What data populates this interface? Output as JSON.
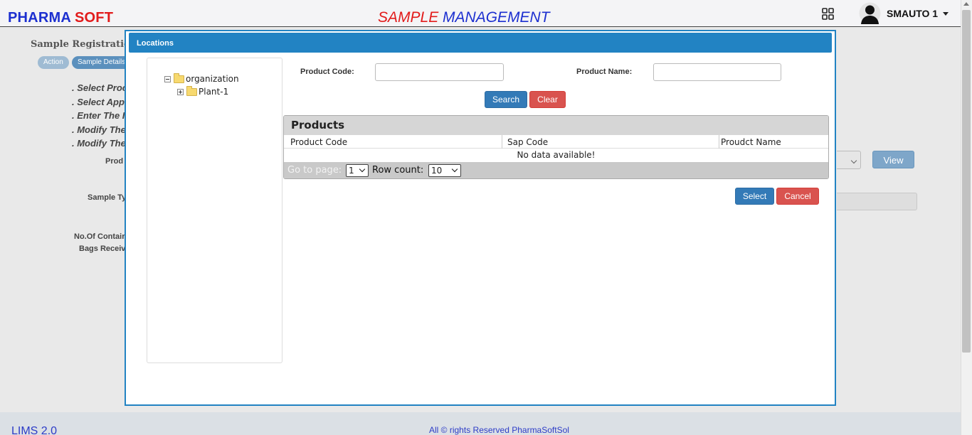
{
  "header": {
    "brand_part1": "PHARMA",
    "brand_part2": "SOFT",
    "title_part1": "SAMPLE",
    "title_part2": "MANAGEMENT",
    "apps_icon": "grid-icon",
    "username": "SMAUTO 1"
  },
  "background": {
    "page_title": "Sample Registration",
    "pills": [
      "Action",
      "Sample Details"
    ],
    "instructions": [
      ". Select Proc",
      ". Select App",
      ". Enter The I",
      ". Modify The",
      ". Modify The"
    ],
    "labels": [
      "Prod",
      "Sample Ty",
      "No.Of Contair",
      "Bags Receiv"
    ],
    "view_button": "View"
  },
  "modal": {
    "title": "Locations",
    "tree": {
      "root": "organization",
      "children": [
        "Plant-1"
      ]
    },
    "product_code_label": "Product Code:",
    "product_code_value": "",
    "product_name_label": "Product Name:",
    "product_name_value": "",
    "search_button": "Search",
    "clear_button": "Clear",
    "grid": {
      "caption": "Products",
      "columns": [
        "Product Code",
        "Sap Code",
        "Proudct Name"
      ],
      "empty_text": "No data available!",
      "go_to_page_label": "Go to page:",
      "page_value": "1",
      "row_count_label": "Row count:",
      "row_count_value": "10"
    },
    "select_button": "Select",
    "cancel_button": "Cancel"
  },
  "footer": {
    "version": "LIMS 2.0",
    "copyright": "All © rights Reserved PharmaSoftSol"
  },
  "colors": {
    "brand_blue": "#1c2fd0",
    "brand_red": "#e21b1b",
    "modal_accent": "#2283c3",
    "primary_button": "#337ab7",
    "danger_button": "#d9534f"
  }
}
